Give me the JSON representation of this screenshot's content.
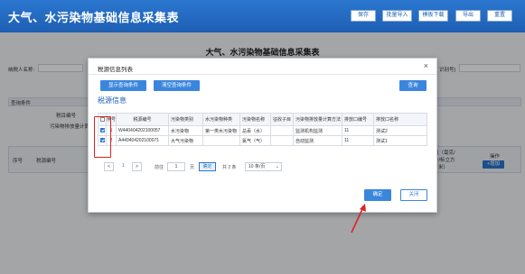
{
  "header": {
    "title": "大气、水污染物基础信息采集表",
    "buttons": [
      "保存",
      "批量导入",
      "模板下载",
      "导出",
      "重置"
    ]
  },
  "background": {
    "form_title": "大气、水污染物基础信息采集表",
    "taxpayer_label": "纳税人名称:",
    "right_fragment": "识别号)",
    "query_condition_label": "查询条件",
    "tax_item_label": "税目编号",
    "calc_method_label": "污染物排放量计算",
    "table_headers": [
      "序号",
      "税源编号",
      "值（毫克/",
      "升/标立方",
      "米）"
    ],
    "operation_label": "操作",
    "add_button": "+增加"
  },
  "modal": {
    "title": "税源信息列表",
    "close_icon": "×",
    "show_query_button": "显示查询条件",
    "clear_query_button": "清空查询条件",
    "query_button": "查询",
    "section_title": "税源信息",
    "columns": [
      "",
      "序号",
      "税源编号",
      "污染物类别",
      "水污染物种类",
      "污染物名称",
      "征收子目",
      "污染物排放量计算方法",
      "排放口编号",
      "排放口名称"
    ],
    "rows": [
      {
        "checked": true,
        "seq": "1",
        "code": "W440404202100057",
        "category": "水污染物",
        "water_type": "第一类水污染物",
        "name": "总汞（水）",
        "sub_item": "",
        "method": "监测机构监测",
        "outlet_no": "11",
        "outlet_name": "测试2"
      },
      {
        "checked": true,
        "seq": "2",
        "code": "A440404202100071",
        "category": "大气污染物",
        "water_type": "",
        "name": "氯气（气）",
        "sub_item": "",
        "method": "自动监测",
        "outlet_no": "11",
        "outlet_name": "测试1"
      }
    ],
    "pager": {
      "prev": "<",
      "page": "1",
      "next": ">",
      "goto_label": "前往",
      "goto_value": "1",
      "page_unit": "页",
      "confirm": "确定",
      "total": "共 2 条",
      "page_size": "10 条/页"
    },
    "ok_button": "确定",
    "close_button": "关闭"
  },
  "colors": {
    "header_bg": "#2b77cf",
    "accent": "#3b86dd",
    "highlight": "#e02020"
  }
}
